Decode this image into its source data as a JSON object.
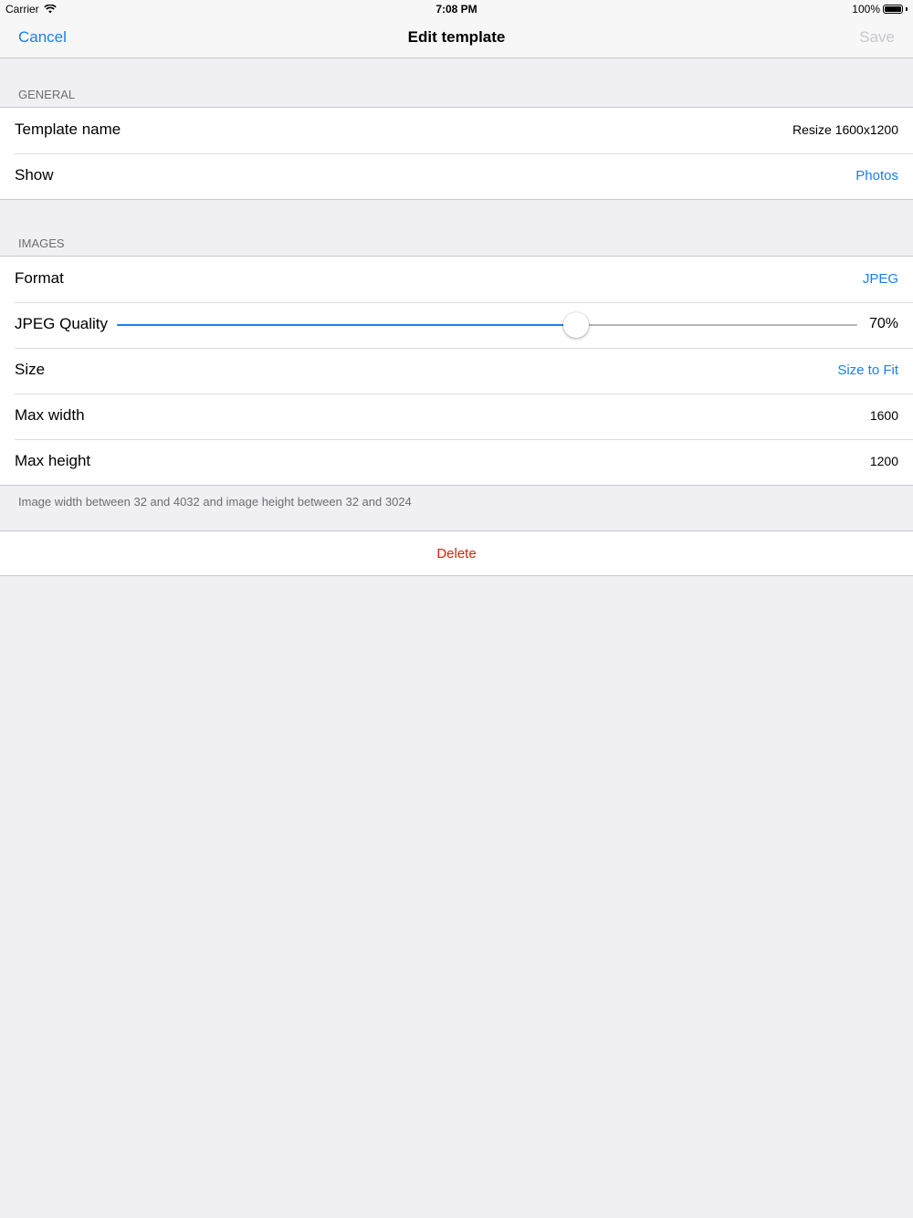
{
  "status_bar": {
    "carrier": "Carrier",
    "wifi_icon": "wifi-icon",
    "time": "7:08 PM",
    "battery": "100%",
    "battery_icon": "battery-icon"
  },
  "nav": {
    "cancel_label": "Cancel",
    "title": "Edit template",
    "save_label": "Save"
  },
  "general": {
    "header": "GENERAL",
    "rows": [
      {
        "label": "Template name",
        "value": "Resize 1600x1200"
      },
      {
        "label": "Show",
        "value": "Photos"
      }
    ]
  },
  "images": {
    "header": "IMAGES",
    "format": {
      "label": "Format",
      "value": "JPEG"
    },
    "quality": {
      "label": "JPEG Quality",
      "value_text": "70%",
      "level": 0.62
    },
    "size": {
      "label": "Size",
      "value": "Size to Fit"
    },
    "max_width": {
      "label": "Max width",
      "value": "1600"
    },
    "max_height": {
      "label": "Max height",
      "value": "1200"
    },
    "footer": "Image width between 32 and 4032 and image height between 32 and 3024"
  },
  "delete_label": "Delete",
  "colors": {
    "accent": "#1a7ef0",
    "destructive": "#d0230f",
    "background": "#efeff4"
  }
}
